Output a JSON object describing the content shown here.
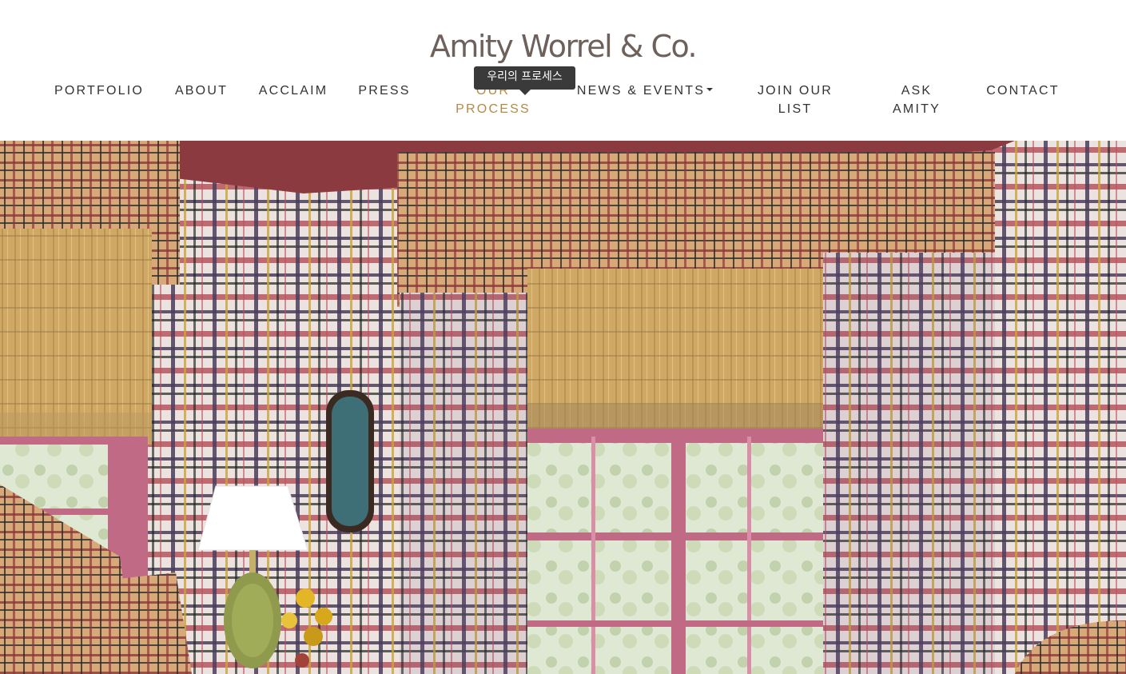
{
  "brand": {
    "logo_text": "Amity Worrel & Co."
  },
  "nav": {
    "portfolio": "PORTFOLIO",
    "about": "ABOUT",
    "acclaim": "ACCLAIM",
    "press": "PRESS",
    "our_process_line1": "OUR",
    "our_process_line2": "PROCESS",
    "news_events": "NEWS & EVENTS",
    "join_line1": "JOIN OUR",
    "join_line2": "LIST",
    "ask_line1": "ASK",
    "ask_line2": "AMITY",
    "contact": "CONTACT"
  },
  "tooltip": {
    "text": "우리의 프로세스"
  },
  "colors": {
    "nav_text": "#333333",
    "nav_active": "#b58a45",
    "logo": "#6e605a",
    "tooltip_bg": "#3a3a3a"
  },
  "icons": {
    "dropdown": "caret-down-icon"
  }
}
